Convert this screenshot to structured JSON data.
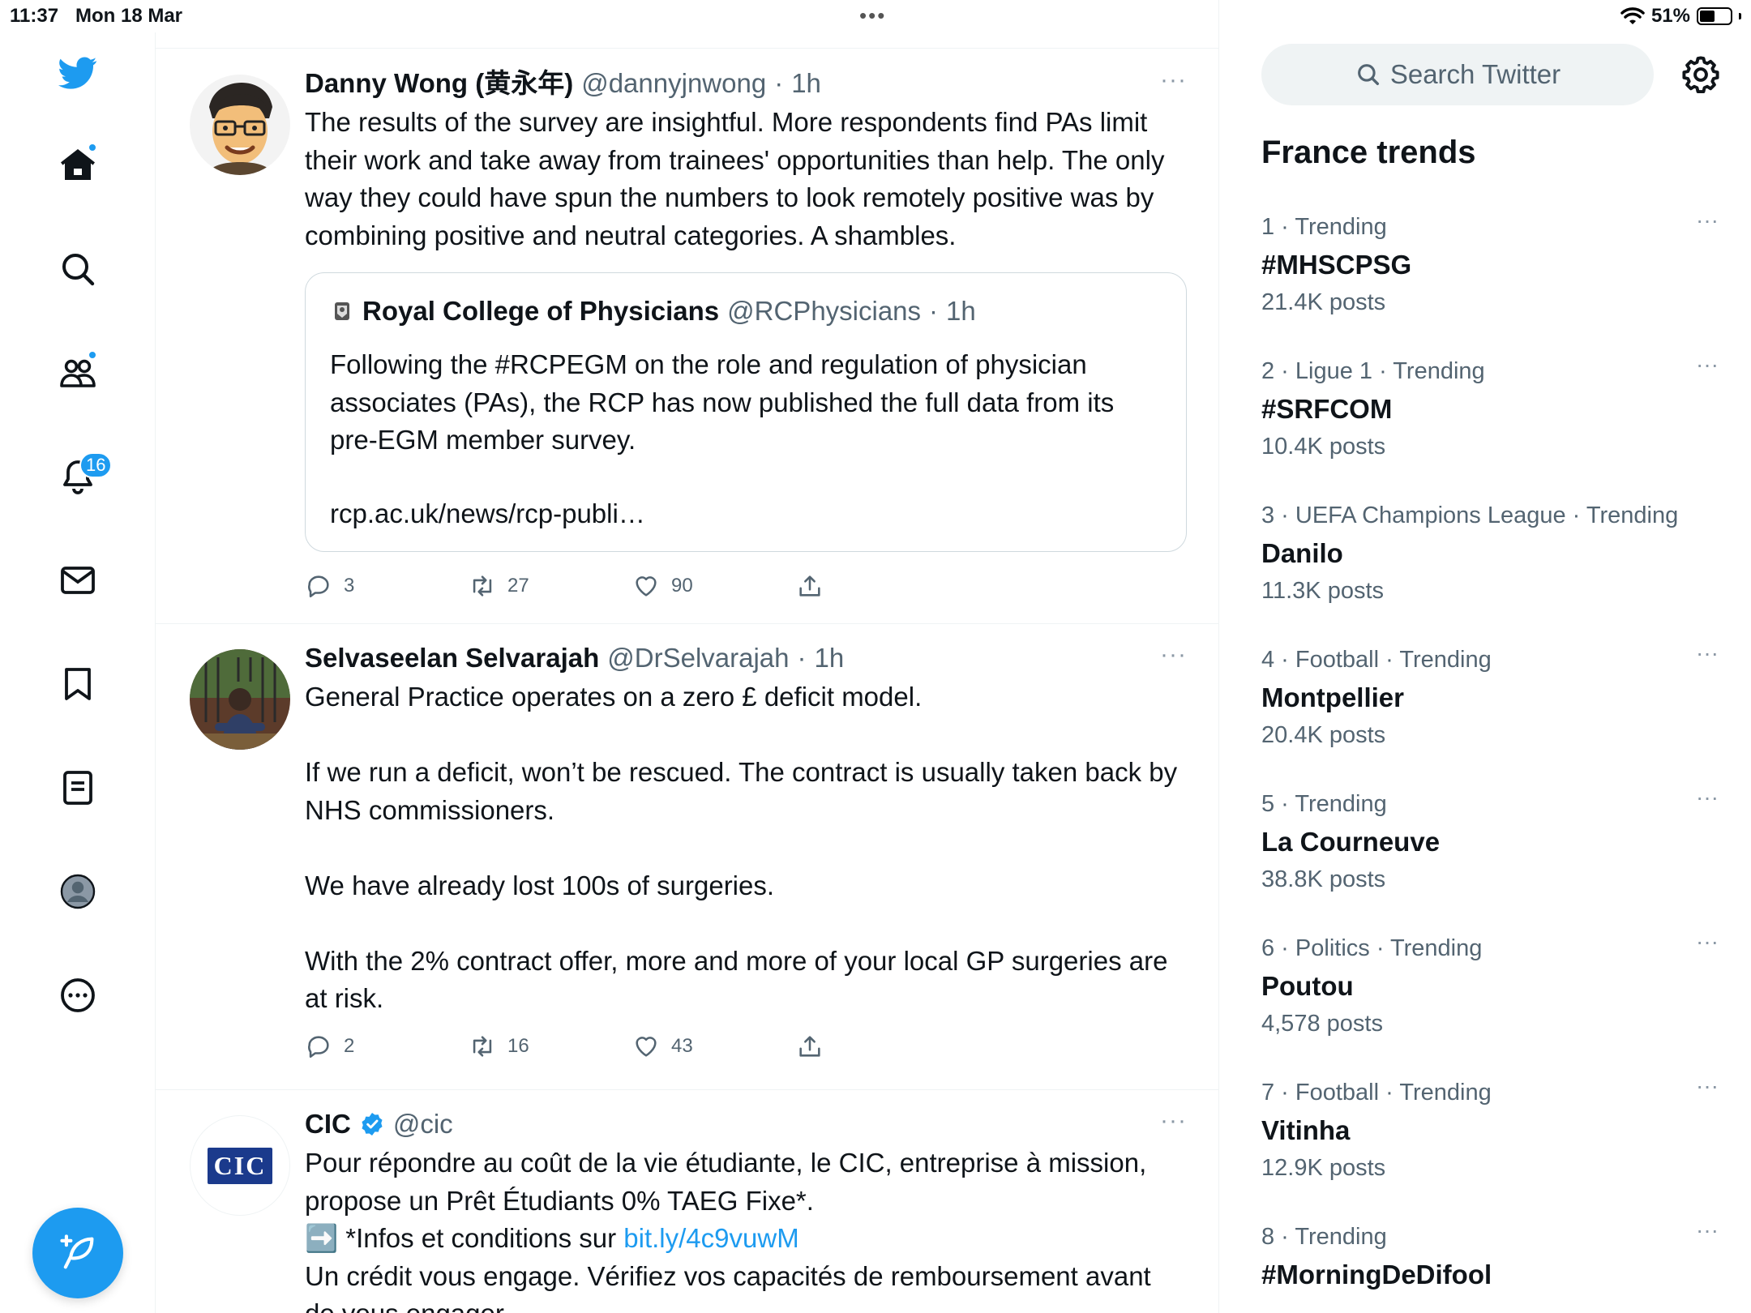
{
  "status_bar": {
    "time": "11:37",
    "date": "Mon 18 Mar",
    "battery": "51%",
    "battery_level": 0.51
  },
  "nav": {
    "notifications_count": "16"
  },
  "tweets": [
    {
      "name": "Danny Wong (黄永年)",
      "handle": "@dannyjnwong",
      "sep": "·",
      "time": "1h",
      "more": "···",
      "text": "The results of the survey are insightful. More respondents find PAs limit their work and take away from trainees' opportunities than help. The only way they could have spun the numbers to look remotely positive was by combining positive and neutral categories. A shambles.",
      "quote": {
        "name": "Royal College of Physicians",
        "handle": "@RCPhysicians",
        "sep": "·",
        "time": "1h",
        "text": "Following the #RCPEGM on the role and regulation of physician associates (PAs), the RCP has now published the full data from its pre-EGM member survey.",
        "link": "rcp.ac.uk/news/rcp-publi…"
      },
      "replies": "3",
      "retweets": "27",
      "likes": "90"
    },
    {
      "name": "Selvaseelan Selvarajah",
      "handle": "@DrSelvarajah",
      "sep": "·",
      "time": "1h",
      "more": "···",
      "text": "General Practice operates on a zero £ deficit model.\n\nIf we run a deficit, won’t be rescued. The contract is usually taken back by NHS commissioners.\n\nWe have already lost 100s of surgeries.\n\nWith the 2% contract offer, more and more of your local GP surgeries are at risk.",
      "replies": "2",
      "retweets": "16",
      "likes": "43"
    },
    {
      "name": "CIC",
      "handle": "@cic",
      "more": "···",
      "avatar_text": "CIC",
      "text_1": "Pour répondre au coût de la vie étudiante, le CIC, entreprise à mission, propose un Prêt Étudiants 0% TAEG Fixe*.",
      "text_2_prefix": "➡️ *Infos et conditions sur ",
      "text_2_link": "bit.ly/4c9vuwM",
      "text_3": "Un crédit vous engage. Vérifiez vos capacités de remboursement avant de vous engager."
    }
  ],
  "search": {
    "placeholder": "Search Twitter"
  },
  "trends": {
    "title": "France trends",
    "more": "···",
    "items": [
      {
        "meta": "1 · Trending",
        "name": "#MHSCPSG",
        "count": "21.4K posts"
      },
      {
        "meta": "2 · Ligue 1 · Trending",
        "name": "#SRFCOM",
        "count": "10.4K posts"
      },
      {
        "meta": "3 · UEFA Champions League · Trending",
        "name": "Danilo",
        "count": "11.3K posts"
      },
      {
        "meta": "4 · Football · Trending",
        "name": "Montpellier",
        "count": "20.4K posts"
      },
      {
        "meta": "5 · Trending",
        "name": "La Courneuve",
        "count": "38.8K posts"
      },
      {
        "meta": "6 · Politics · Trending",
        "name": "Poutou",
        "count": "4,578 posts"
      },
      {
        "meta": "7 · Football · Trending",
        "name": "Vitinha",
        "count": "12.9K posts"
      },
      {
        "meta": "8 · Trending",
        "name": "#MorningDeDifool",
        "count": ""
      }
    ]
  },
  "colors": {
    "accent": "#1d9bf0",
    "text_primary": "#0f1419",
    "text_secondary": "#536471",
    "border": "#eff3f4"
  }
}
